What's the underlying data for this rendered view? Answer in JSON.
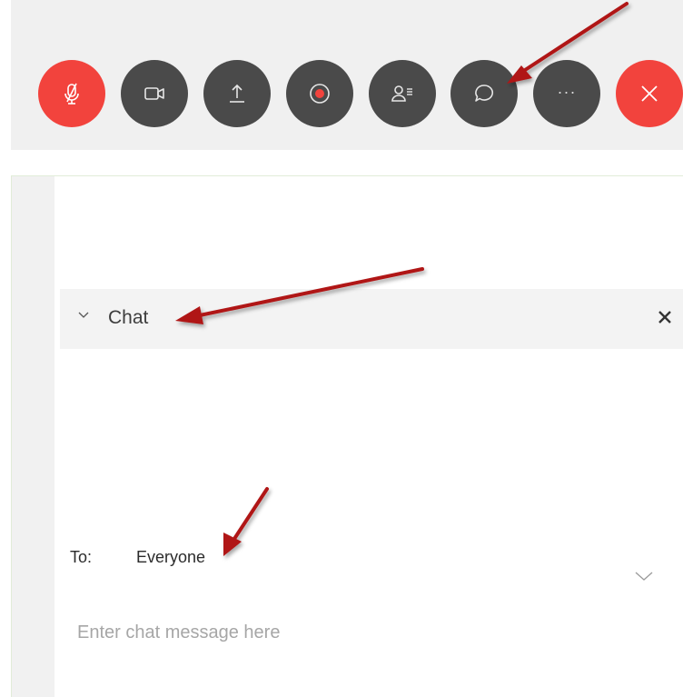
{
  "colors": {
    "toolbar_bg": "#f0f0f0",
    "button_dark": "#4a4a4a",
    "button_red": "#f2433d",
    "annotation_arrow": "#b01515"
  },
  "toolbar": {
    "buttons": [
      {
        "name": "mute-button",
        "icon": "microphone-muted-icon",
        "color": "red"
      },
      {
        "name": "video-button",
        "icon": "video-camera-icon",
        "color": "dark"
      },
      {
        "name": "share-button",
        "icon": "upload-share-icon",
        "color": "dark"
      },
      {
        "name": "record-button",
        "icon": "record-icon",
        "color": "dark"
      },
      {
        "name": "participants-button",
        "icon": "participants-list-icon",
        "color": "dark"
      },
      {
        "name": "chat-button",
        "icon": "chat-bubble-icon",
        "color": "dark"
      },
      {
        "name": "more-options-button",
        "icon": "ellipsis-icon",
        "color": "dark",
        "label": "···"
      },
      {
        "name": "leave-meeting-button",
        "icon": "close-x-icon",
        "color": "red"
      }
    ]
  },
  "chat_panel": {
    "title": "Chat",
    "collapse_icon": "chevron-down-icon",
    "close_icon": "close-icon",
    "to_label": "To:",
    "recipient": "Everyone",
    "recipient_dropdown_icon": "chevron-down-icon",
    "message_placeholder": "Enter chat message here"
  },
  "annotations": {
    "arrows": [
      "arrow-to-chat-button",
      "arrow-to-chat-header",
      "arrow-to-recipient"
    ]
  }
}
